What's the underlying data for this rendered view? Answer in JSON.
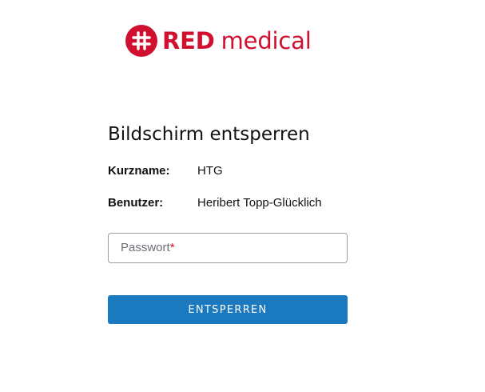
{
  "logo": {
    "brand": "RED",
    "product": "medical",
    "icon": "hash-icon",
    "color": "#d0102f"
  },
  "unlock": {
    "title": "Bildschirm entsperren",
    "short_name_label": "Kurzname:",
    "short_name_value": "HTG",
    "user_label": "Benutzer:",
    "user_value": "Heribert Topp-Glücklich",
    "password_placeholder": "Passwort",
    "password_required_mark": "*",
    "password_value": "",
    "submit_label": "ENTSPERREN"
  },
  "colors": {
    "brand_red": "#d0102f",
    "button_blue": "#1a79bf"
  }
}
